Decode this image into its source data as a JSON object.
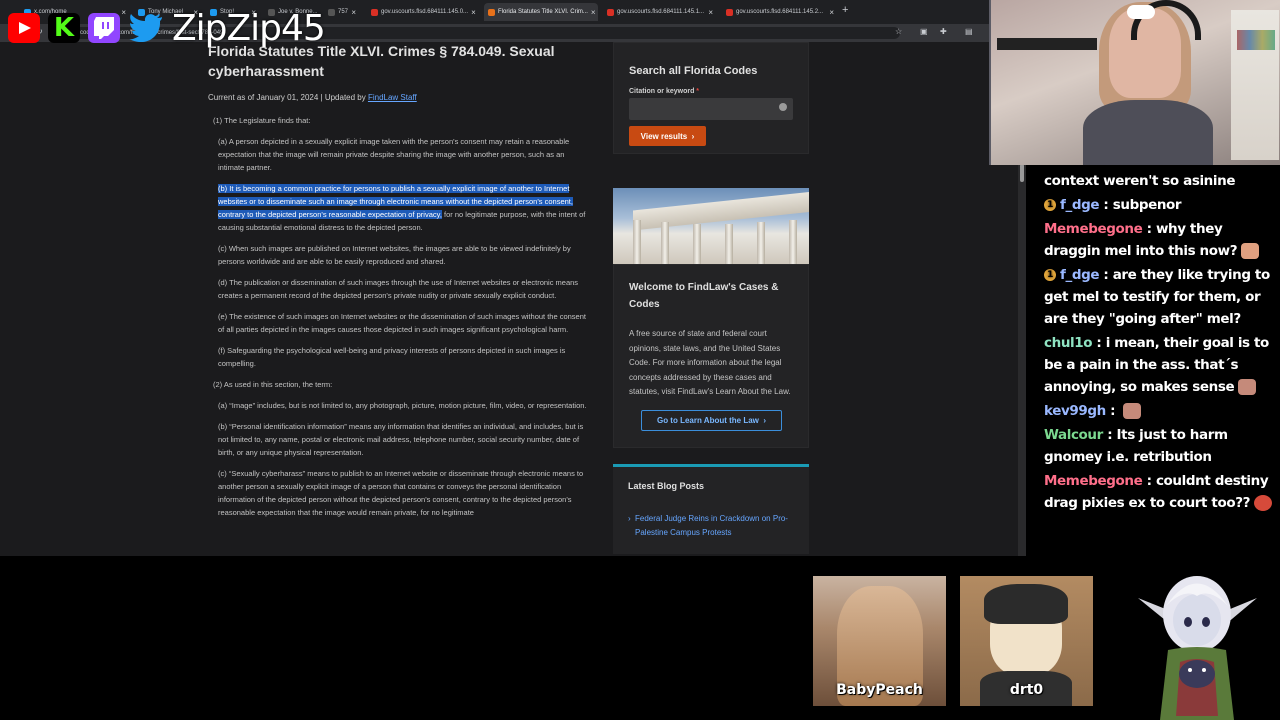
{
  "streamer": {
    "handle": "ZipZip45"
  },
  "browser": {
    "tabs": [
      {
        "label": "x.com/home",
        "favicon_color": "#1d9bf0"
      },
      {
        "label": "Tony Michael",
        "favicon_color": "#1d9bf0"
      },
      {
        "label": "Stop!",
        "favicon_color": "#1d9bf0"
      },
      {
        "label": "Joe v. Bonne...",
        "favicon_color": "#555555"
      },
      {
        "label": "757",
        "favicon_color": "#555555"
      },
      {
        "label": "gov.uscourts.flsd.684111.145.0...",
        "favicon_color": "#d93025"
      },
      {
        "label": "Florida Statutes Title XLVI. Crim...",
        "favicon_color": "#e8711a"
      },
      {
        "label": "gov.uscourts.flsd.684111.145.1...",
        "favicon_color": "#d93025"
      },
      {
        "label": "gov.uscourts.flsd.684111.145.2...",
        "favicon_color": "#d93025"
      }
    ],
    "url": "codes.findlaw.com/fl/title-xlvi-crimes/fl-st-sect-784-049/"
  },
  "article": {
    "title": "Florida Statutes Title XLVI. Crimes § 784.049. Sexual cyberharassment",
    "meta_prefix": "Current as of January 01, 2024 | Updated by ",
    "meta_link": "FindLaw Staff",
    "p1": "(1) The Legislature finds that:",
    "p1a": "(a) A person depicted in a sexually explicit image taken with the person's consent may retain a reasonable expectation that the image will remain private despite sharing the image with another person, such as an intimate partner.",
    "p1b_highlight": "(b) It is becoming a common practice for persons to publish a sexually explicit image of another to Internet websites or to disseminate such an image through electronic means without the depicted person's consent, contrary to the depicted person's reasonable expectation of privacy,",
    "p1b_rest": " for no legitimate purpose, with the intent of causing substantial emotional distress to the depicted person.",
    "p1c": "(c) When such images are published on Internet websites, the images are able to be viewed indefinitely by persons worldwide and are able to be easily reproduced and shared.",
    "p1d": "(d) The publication or dissemination of such images through the use of Internet websites or electronic means creates a permanent record of the depicted person's private nudity or private sexually explicit conduct.",
    "p1e": "(e) The existence of such images on Internet websites or the dissemination of such images without the consent of all parties depicted in the images causes those depicted in such images significant psychological harm.",
    "p1f": "(f) Safeguarding the psychological well-being and privacy interests of persons depicted in such images is compelling.",
    "p2": "(2) As used in this section, the term:",
    "p2a": "(a) “Image” includes, but is not limited to, any photograph, picture, motion picture, film, video, or representation.",
    "p2b": "(b) “Personal identification information” means any information that identifies an individual, and includes, but is not limited to, any name, postal or electronic mail address, telephone number, social security number, date of birth, or any unique physical representation.",
    "p2c": "(c) “Sexually cyberharass” means to publish to an Internet website or disseminate through electronic means to another person a sexually explicit image of a person that contains or conveys the personal identification information of the depicted person without the depicted person's consent, contrary to the depicted person's reasonable expectation that the image would remain private, for no legitimate"
  },
  "sidebar": {
    "search_title": "Search all Florida Codes",
    "citation_label": "Citation or keyword",
    "required_mark": "*",
    "view_button": "View results",
    "welcome_title": "Welcome to FindLaw's Cases & Codes",
    "welcome_text": "A free source of state and federal court opinions, state laws, and the United States Code. For more information about the legal concepts addressed by these cases and statutes, visit FindLaw's Learn About the Law.",
    "learn_button": "Go to Learn About the Law",
    "blog_title": "Latest Blog Posts",
    "blog_link": "Federal Judge Reins in Crackdown on Pro-Palestine Campus Protests"
  },
  "chat": [
    {
      "user": "",
      "color": "#ffffff",
      "text": "context weren't so asinine",
      "badge": false,
      "emote": ""
    },
    {
      "user": "f_dge",
      "color": "#9ab8ff",
      "text": "subpenor",
      "badge": true,
      "emote": ""
    },
    {
      "user": "Memebegone",
      "color": "#ff6f8a",
      "text": "why they draggin mel into this now?",
      "badge": false,
      "emote": "#e0a080"
    },
    {
      "user": "f_dge",
      "color": "#9ab8ff",
      "text": "are they like trying to get mel to testify for them, or are they \"going after\" mel?",
      "badge": true,
      "emote": ""
    },
    {
      "user": "chul1o",
      "color": "#8fe3c2",
      "text": "i mean, their goal is to be a pain in the ass. that´s annoying, so makes sense",
      "badge": false,
      "emote": "#c58a7a"
    },
    {
      "user": "kev99gh",
      "color": "#9ab8ff",
      "text": "",
      "badge": false,
      "emote": "#c58a7a"
    },
    {
      "user": "Walcour",
      "color": "#7bd88f",
      "text": "Its just to harm gnomey i.e. retribution",
      "badge": false,
      "emote": ""
    },
    {
      "user": "Memebegone",
      "color": "#ff6f8a",
      "text": "couldnt destiny drag pixies ex to court too??",
      "badge": false,
      "emote": "#d64a3a"
    }
  ],
  "guests": [
    {
      "name": "BabyPeach"
    },
    {
      "name": "drt0"
    }
  ]
}
